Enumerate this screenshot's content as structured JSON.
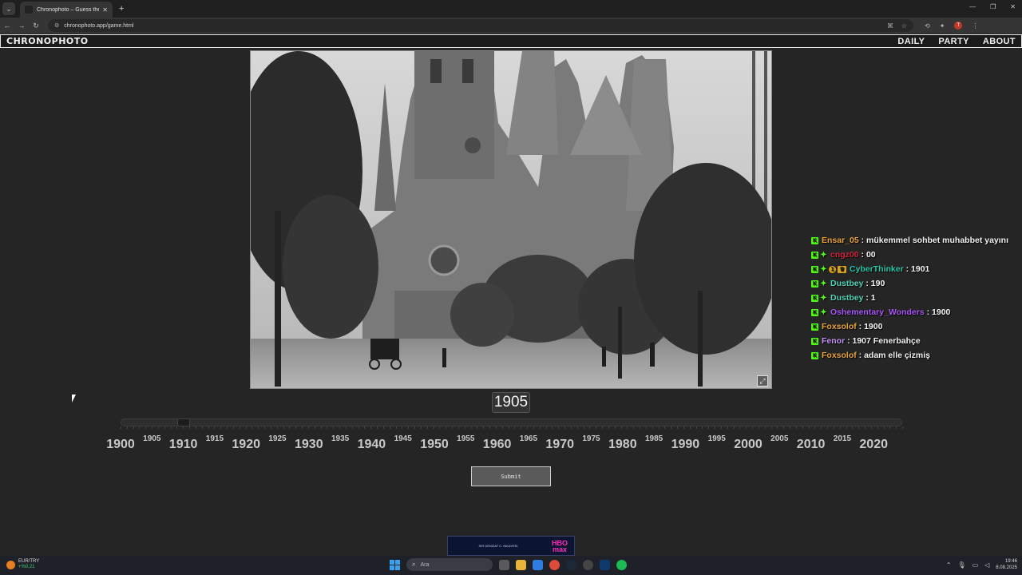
{
  "browser": {
    "tab_title": "Chronophoto – Guess the Year",
    "url": "chronophoto.app/game.html",
    "new_tab_label": "+",
    "tab_close_label": "✕",
    "profile_initial": "T"
  },
  "site": {
    "logo": "CHRONOPHOTO",
    "nav": [
      "DAILY",
      "PARTY",
      "ABOUT"
    ]
  },
  "game": {
    "current_year": "1905",
    "submit_label": "Submit",
    "slider": {
      "min": 1900,
      "max": 2025,
      "value": 1905
    },
    "year_labels": [
      "1900",
      "1905",
      "1910",
      "1915",
      "1920",
      "1925",
      "1930",
      "1935",
      "1940",
      "1945",
      "1950",
      "1955",
      "1960",
      "1965",
      "1970",
      "1975",
      "1980",
      "1985",
      "1990",
      "1995",
      "2000",
      "2005",
      "2010",
      "2015",
      "2020"
    ]
  },
  "chat": [
    {
      "badges": [
        "k"
      ],
      "user": "Ensar_05",
      "user_color": "#e8a23a",
      "message": ": mükemmel sohbet muhabbet yayını"
    },
    {
      "badges": [
        "k",
        "star"
      ],
      "user": "cngz00",
      "user_color": "#d0243c",
      "message": ": 00"
    },
    {
      "badges": [
        "k",
        "star",
        "coin",
        "crown"
      ],
      "user": "CyberThinker",
      "user_color": "#26c6a6",
      "message": ": 1901"
    },
    {
      "badges": [
        "k",
        "star"
      ],
      "user": "Dustbey",
      "user_color": "#4fd3b5",
      "message": ": 190"
    },
    {
      "badges": [
        "k",
        "star"
      ],
      "user": "Dustbey",
      "user_color": "#4fd3b5",
      "message": ": 1"
    },
    {
      "badges": [
        "k",
        "star"
      ],
      "user": "Oshementary_Wonders",
      "user_color": "#a855f7",
      "message": ": 1900"
    },
    {
      "badges": [
        "k"
      ],
      "user": "Foxsolof",
      "user_color": "#e8a23a",
      "message": ": 1900"
    },
    {
      "badges": [
        "k"
      ],
      "user": "Fenor",
      "user_color": "#c490f5",
      "message": ": 1907 Fenerbahçe"
    },
    {
      "badges": [
        "k"
      ],
      "user": "Foxsolof",
      "user_color": "#e8a23a",
      "message": ": adam elle çizmiş"
    }
  ],
  "ad": {
    "small_text": "SIR DENIZAT C. NIKAYESI",
    "brand_line1": "HBO",
    "brand_line2": "max"
  },
  "taskbar": {
    "weather_title": "EUR/TRY",
    "weather_sub": "+%0,21",
    "search_placeholder": "Ara",
    "time": "19:46",
    "date": "8.08.2025"
  }
}
